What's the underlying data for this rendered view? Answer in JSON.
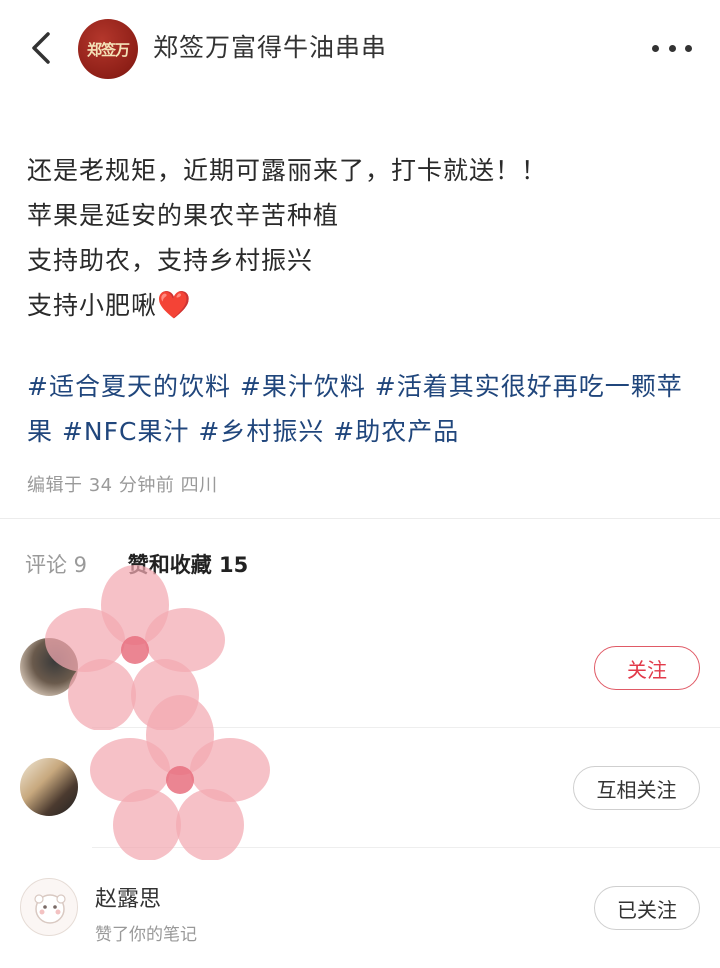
{
  "header": {
    "back_icon": "chevron-left-icon",
    "logo_text": "郑签万",
    "shop_name": "郑签万富得牛油串串",
    "more_icon": "more-dots-icon"
  },
  "post": {
    "lines": [
      "还是老规矩，近期可露丽来了，打卡就送！！",
      "苹果是延安的果农辛苦种植",
      "支持助农，支持乡村振兴",
      "支持小肥啾"
    ],
    "heart": "❤️",
    "tags_line1": "#适合夏天的饮料 #果汁饮料 #活着其实很好再吃一颗苹",
    "tags_line2": "果 #NFC果汁 #乡村振兴 #助农产品",
    "meta": "编辑于 34 分钟前 四川"
  },
  "tabs": {
    "comments": "评论 9",
    "likes": "赞和收藏 15"
  },
  "users": [
    {
      "name": "",
      "action": "",
      "button": "关注"
    },
    {
      "name": "",
      "action": "",
      "button": "互相关注"
    },
    {
      "name": "赵露思",
      "action": "赞了你的笔记",
      "button": "已关注"
    }
  ],
  "colors": {
    "tag": "#20467c",
    "follow_border": "#e05a66",
    "follow_text": "#e23a4a",
    "heart": "#e52b2b"
  }
}
